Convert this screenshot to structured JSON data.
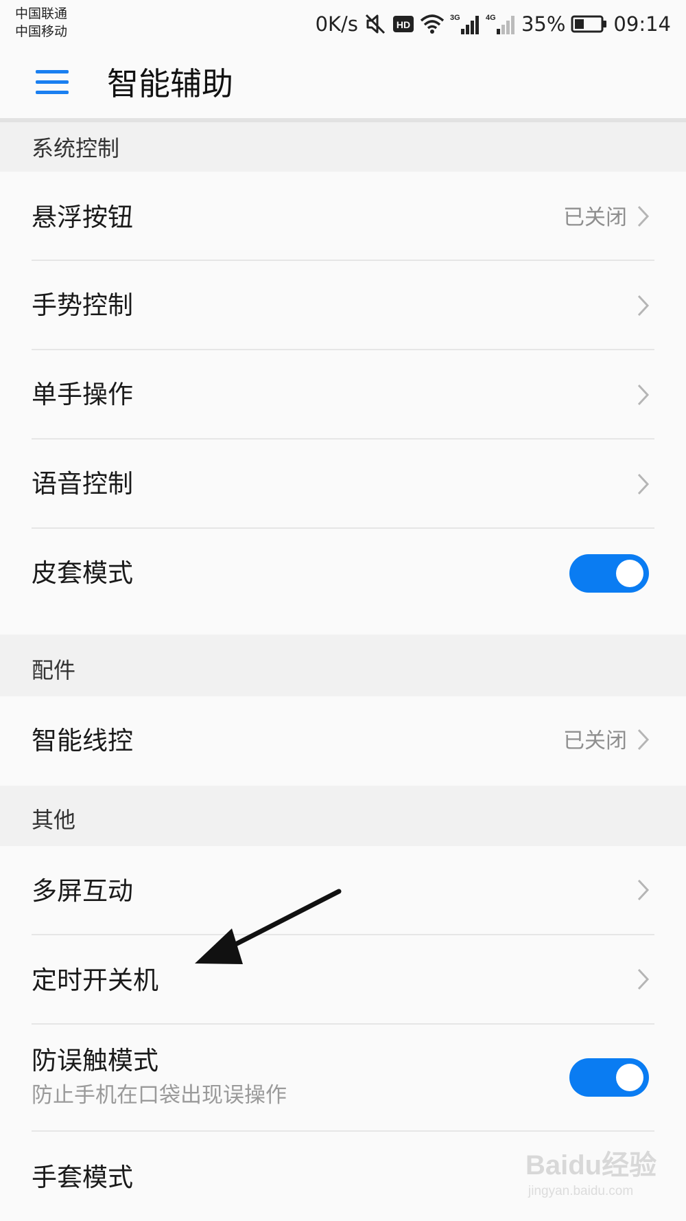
{
  "status_bar": {
    "carrier_1": "中国联通",
    "carrier_2": "中国移动",
    "net_speed": "0K/s",
    "hd_badge": "HD",
    "signal_1_label": "3G",
    "signal_2_label": "4G",
    "battery_percent": "35%",
    "battery_level": 0.35,
    "time": "09:14",
    "icons": [
      "mute-icon",
      "hd-icon",
      "wifi-icon",
      "signal-3g-icon",
      "signal-4g-icon",
      "battery-icon"
    ]
  },
  "header": {
    "title": "智能辅助",
    "menu_icon": "hamburger-menu-icon",
    "accent_color": "#1a7ff0"
  },
  "sections": {
    "system_control": {
      "title": "系统控制",
      "items": [
        {
          "label": "悬浮按钮",
          "value": "已关闭",
          "type": "link"
        },
        {
          "label": "手势控制",
          "type": "link"
        },
        {
          "label": "单手操作",
          "type": "link"
        },
        {
          "label": "语音控制",
          "type": "link"
        },
        {
          "label": "皮套模式",
          "type": "toggle",
          "on": true
        }
      ]
    },
    "accessories": {
      "title": "配件",
      "items": [
        {
          "label": "智能线控",
          "value": "已关闭",
          "type": "link"
        }
      ]
    },
    "other": {
      "title": "其他",
      "items": [
        {
          "label": "多屏互动",
          "type": "link"
        },
        {
          "label": "定时开关机",
          "type": "link"
        },
        {
          "label": "防误触模式",
          "sublabel": "防止手机在口袋出现误操作",
          "type": "toggle",
          "on": true
        },
        {
          "label": "手套模式",
          "type": "link"
        }
      ]
    }
  },
  "colors": {
    "toggle_on": "#0a7cf2",
    "section_bg": "#f1f1f1",
    "page_bg": "#fafafa",
    "annotation_arrow": "#111111"
  },
  "watermark": {
    "main": "Baidu经验",
    "sub": "jingyan.baidu.com"
  }
}
